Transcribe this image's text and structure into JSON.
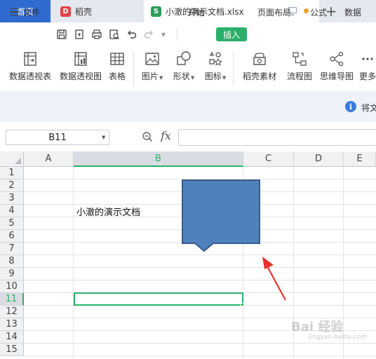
{
  "tabs": {
    "home": "首页",
    "daoke": "稻壳",
    "file": "小澈的演示文档.xlsx",
    "daoke_logo": "D",
    "sheet_logo": "S"
  },
  "menu": {
    "file": "文件",
    "start": "开始",
    "insert": "插入",
    "page_layout": "页面布局",
    "formula": "公式",
    "data": "数据"
  },
  "ribbon": {
    "pivot_table": "数据透视表",
    "pivot_chart": "数据透视图",
    "table": "表格",
    "picture": "图片",
    "shapes": "形状",
    "icons": "图标",
    "daoke_material": "稻壳素材",
    "flowchart": "流程图",
    "mindmap": "思维导图",
    "more": "更多"
  },
  "info": {
    "text": "将文"
  },
  "formula_bar": {
    "name_box": "B11",
    "fx": "fx",
    "value": ""
  },
  "grid": {
    "columns": [
      "A",
      "B",
      "C",
      "D",
      "E"
    ],
    "selected_column": "B",
    "rows": [
      "1",
      "2",
      "3",
      "4",
      "5",
      "6",
      "7",
      "8",
      "9",
      "10",
      "11",
      "12",
      "13",
      "14",
      "15"
    ],
    "selected_row": "11",
    "cell_b4": "小澈的演示文档"
  },
  "watermark": {
    "main": "Bai 经验",
    "sub": "jingyan.baidu.com"
  },
  "colors": {
    "accent_green": "#2ab06a",
    "tab_blue": "#2f6bcf",
    "shape_fill": "#4f81bd",
    "arrow_red": "#e8312f"
  }
}
